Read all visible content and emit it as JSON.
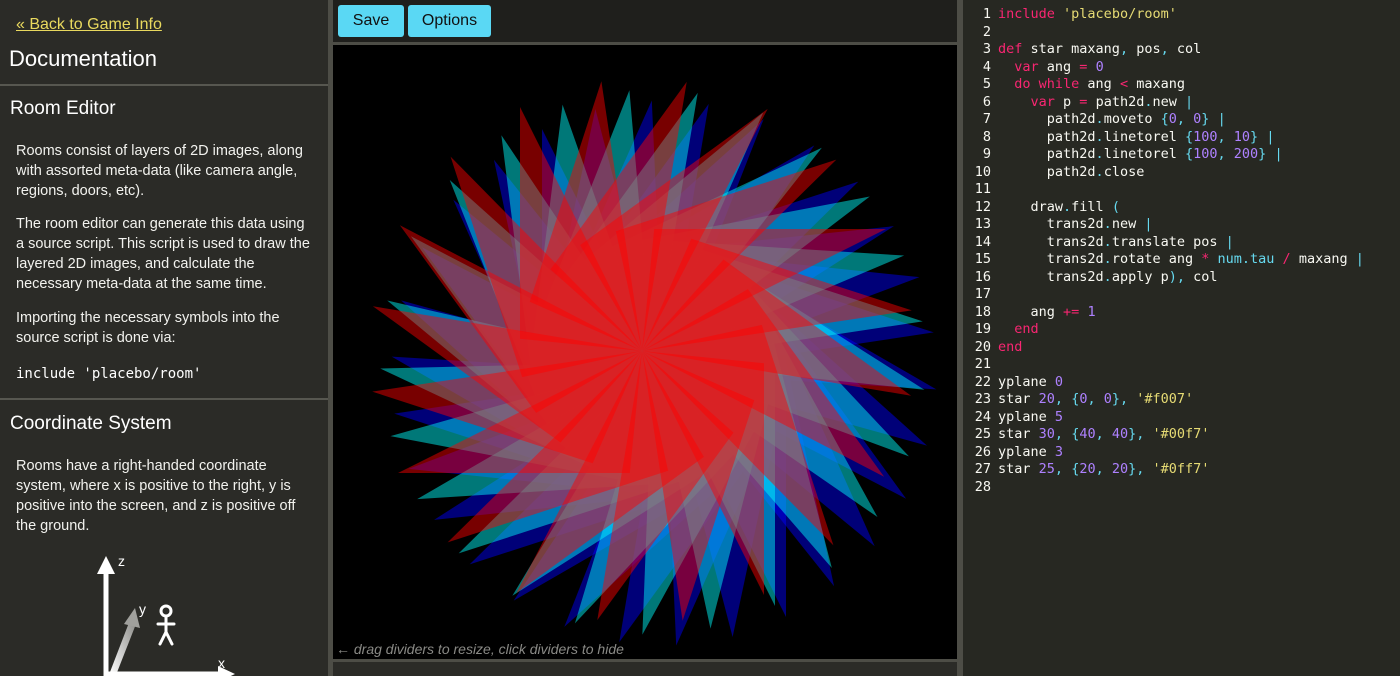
{
  "docs": {
    "back_link": "« Back to Game Info",
    "title": "Documentation",
    "sections": [
      {
        "heading": "Room Editor",
        "paragraphs": [
          "Rooms consist of layers of 2D images, along with assorted meta-data (like camera angle, regions, doors, etc).",
          "The room editor can generate this data using a source script. This script is used to draw the layered 2D images, and calculate the necessary meta-data at the same time.",
          "Importing the necessary symbols into the source script is done via:"
        ],
        "code": "include 'placebo/room'"
      },
      {
        "heading": "Coordinate System",
        "paragraphs": [
          "Rooms have a right-handed coordinate system, where x is positive to the right, y is positive into the screen, and z is positive off the ground."
        ],
        "axis_labels": {
          "z": "z",
          "y": "y",
          "x": "x"
        }
      }
    ]
  },
  "toolbar": {
    "save_label": "Save",
    "options_label": "Options"
  },
  "preview": {
    "hint": "← drag dividers to resize, click dividers to hide",
    "stars": [
      {
        "count": 30,
        "color": "#00f7",
        "fill": "#0000ff",
        "opacity": 0.47
      },
      {
        "count": 25,
        "color": "#0ff7",
        "fill": "#00ffff",
        "opacity": 0.47
      },
      {
        "count": 20,
        "color": "#f007",
        "fill": "#ff0000",
        "opacity": 0.47
      }
    ]
  },
  "editor": {
    "lines": [
      [
        [
          "kw",
          "include"
        ],
        [
          "t",
          " "
        ],
        [
          "str",
          "'placebo/room'"
        ]
      ],
      [],
      [
        [
          "kw",
          "def"
        ],
        [
          "t",
          " star maxang"
        ],
        [
          "punc",
          ","
        ],
        [
          "t",
          " pos"
        ],
        [
          "punc",
          ","
        ],
        [
          "t",
          " col"
        ]
      ],
      [
        [
          "t",
          "  "
        ],
        [
          "kw",
          "var"
        ],
        [
          "t",
          " ang "
        ],
        [
          "kw",
          "="
        ],
        [
          "t",
          " "
        ],
        [
          "num",
          "0"
        ]
      ],
      [
        [
          "t",
          "  "
        ],
        [
          "kw",
          "do while"
        ],
        [
          "t",
          " ang "
        ],
        [
          "kw",
          "<"
        ],
        [
          "t",
          " maxang"
        ]
      ],
      [
        [
          "t",
          "    "
        ],
        [
          "kw",
          "var"
        ],
        [
          "t",
          " p "
        ],
        [
          "kw",
          "="
        ],
        [
          "t",
          " path2d"
        ],
        [
          "punc",
          "."
        ],
        [
          "t",
          "new "
        ],
        [
          "punc",
          "|"
        ]
      ],
      [
        [
          "t",
          "      path2d"
        ],
        [
          "punc",
          "."
        ],
        [
          "t",
          "moveto "
        ],
        [
          "punc",
          "{"
        ],
        [
          "num",
          "0"
        ],
        [
          "punc",
          ","
        ],
        [
          "t",
          " "
        ],
        [
          "num",
          "0"
        ],
        [
          "punc",
          "}"
        ],
        [
          "t",
          " "
        ],
        [
          "punc",
          "|"
        ]
      ],
      [
        [
          "t",
          "      path2d"
        ],
        [
          "punc",
          "."
        ],
        [
          "t",
          "linetorel "
        ],
        [
          "punc",
          "{"
        ],
        [
          "num",
          "100"
        ],
        [
          "punc",
          ","
        ],
        [
          "t",
          " "
        ],
        [
          "num",
          "10"
        ],
        [
          "punc",
          "}"
        ],
        [
          "t",
          " "
        ],
        [
          "punc",
          "|"
        ]
      ],
      [
        [
          "t",
          "      path2d"
        ],
        [
          "punc",
          "."
        ],
        [
          "t",
          "linetorel "
        ],
        [
          "punc",
          "{"
        ],
        [
          "num",
          "100"
        ],
        [
          "punc",
          ","
        ],
        [
          "t",
          " "
        ],
        [
          "num",
          "200"
        ],
        [
          "punc",
          "}"
        ],
        [
          "t",
          " "
        ],
        [
          "punc",
          "|"
        ]
      ],
      [
        [
          "t",
          "      path2d"
        ],
        [
          "punc",
          "."
        ],
        [
          "t",
          "close"
        ]
      ],
      [],
      [
        [
          "t",
          "    draw"
        ],
        [
          "punc",
          "."
        ],
        [
          "t",
          "fill "
        ],
        [
          "punc",
          "("
        ]
      ],
      [
        [
          "t",
          "      trans2d"
        ],
        [
          "punc",
          "."
        ],
        [
          "t",
          "new "
        ],
        [
          "punc",
          "|"
        ]
      ],
      [
        [
          "t",
          "      trans2d"
        ],
        [
          "punc",
          "."
        ],
        [
          "t",
          "translate pos "
        ],
        [
          "punc",
          "|"
        ]
      ],
      [
        [
          "t",
          "      trans2d"
        ],
        [
          "punc",
          "."
        ],
        [
          "t",
          "rotate ang "
        ],
        [
          "kw",
          "*"
        ],
        [
          "t",
          " "
        ],
        [
          "fn",
          "num.tau"
        ],
        [
          "t",
          " "
        ],
        [
          "kw",
          "/"
        ],
        [
          "t",
          " maxang "
        ],
        [
          "punc",
          "|"
        ]
      ],
      [
        [
          "t",
          "      trans2d"
        ],
        [
          "punc",
          "."
        ],
        [
          "t",
          "apply p"
        ],
        [
          "punc",
          "),"
        ],
        [
          "t",
          " col"
        ]
      ],
      [],
      [
        [
          "t",
          "    ang "
        ],
        [
          "kw",
          "+="
        ],
        [
          "t",
          " "
        ],
        [
          "num",
          "1"
        ]
      ],
      [
        [
          "t",
          "  "
        ],
        [
          "kw",
          "end"
        ]
      ],
      [
        [
          "kw",
          "end"
        ]
      ],
      [],
      [
        [
          "t",
          "yplane "
        ],
        [
          "num",
          "0"
        ]
      ],
      [
        [
          "t",
          "star "
        ],
        [
          "num",
          "20"
        ],
        [
          "punc",
          ","
        ],
        [
          "t",
          " "
        ],
        [
          "punc",
          "{"
        ],
        [
          "num",
          "0"
        ],
        [
          "punc",
          ","
        ],
        [
          "t",
          " "
        ],
        [
          "num",
          "0"
        ],
        [
          "punc",
          "},"
        ],
        [
          "t",
          " "
        ],
        [
          "str",
          "'#f007'"
        ]
      ],
      [
        [
          "t",
          "yplane "
        ],
        [
          "num",
          "5"
        ]
      ],
      [
        [
          "t",
          "star "
        ],
        [
          "num",
          "30"
        ],
        [
          "punc",
          ","
        ],
        [
          "t",
          " "
        ],
        [
          "punc",
          "{"
        ],
        [
          "num",
          "40"
        ],
        [
          "punc",
          ","
        ],
        [
          "t",
          " "
        ],
        [
          "num",
          "40"
        ],
        [
          "punc",
          "},"
        ],
        [
          "t",
          " "
        ],
        [
          "str",
          "'#00f7'"
        ]
      ],
      [
        [
          "t",
          "yplane "
        ],
        [
          "num",
          "3"
        ]
      ],
      [
        [
          "t",
          "star "
        ],
        [
          "num",
          "25"
        ],
        [
          "punc",
          ","
        ],
        [
          "t",
          " "
        ],
        [
          "punc",
          "{"
        ],
        [
          "num",
          "20"
        ],
        [
          "punc",
          ","
        ],
        [
          "t",
          " "
        ],
        [
          "num",
          "20"
        ],
        [
          "punc",
          "},"
        ],
        [
          "t",
          " "
        ],
        [
          "str",
          "'#0ff7'"
        ]
      ],
      []
    ]
  }
}
